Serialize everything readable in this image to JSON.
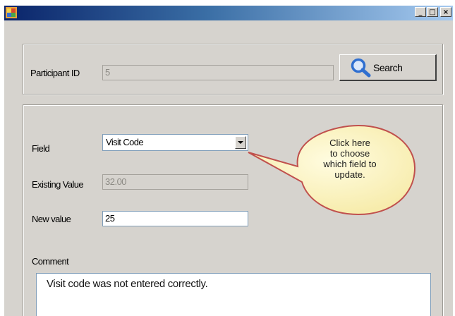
{
  "window": {
    "title": "",
    "controls": [
      "minimize",
      "maximize",
      "close"
    ],
    "icons": {
      "app": "app-icon",
      "minimize": "minimize-icon",
      "maximize": "maximize-icon",
      "close": "close-icon"
    }
  },
  "participant": {
    "label": "Participant ID",
    "value": "5",
    "search_label": "Search",
    "search_icon": "search-icon"
  },
  "form": {
    "field_label": "Field",
    "field_selected": "Visit Code",
    "existing_label": "Existing Value",
    "existing_value": "32.00",
    "new_label": "New value",
    "new_value": "25",
    "comment_label": "Comment",
    "comment_value": "Visit code was not entered correctly."
  },
  "callout": {
    "lines": [
      "Click here",
      "to choose",
      "which field to",
      "update."
    ]
  },
  "colors": {
    "window_bg": "#d6d3ce",
    "titlebar_start": "#0a246a",
    "titlebar_end": "#a6caf0",
    "callout_fill": "#fdf7c8",
    "callout_border": "#c0504d",
    "search_icon": "#2f6fd0"
  }
}
